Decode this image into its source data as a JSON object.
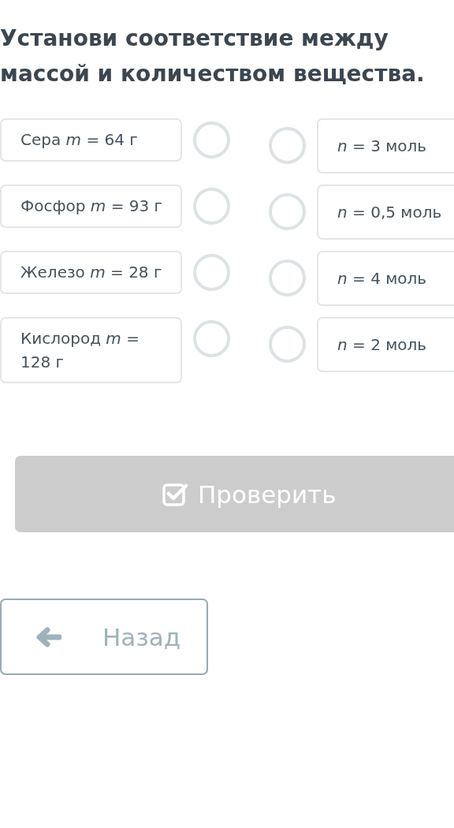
{
  "title": "Установи соответствие между массой и количеством вещества.",
  "left_items": [
    {
      "text": "Сера *m* = 64 г",
      "selected": false
    },
    {
      "text": "Фосфор *m* = 93 г",
      "selected": false
    },
    {
      "text": "Железо *m* = 28 г",
      "selected": false
    },
    {
      "text": "Кислород *m* = 128 г",
      "selected": false
    }
  ],
  "right_items": [
    {
      "text": "*n* = 3 моль",
      "selected": false
    },
    {
      "text": "*n* = 0,5 моль",
      "selected": false
    },
    {
      "text": "*n* = 4 моль",
      "selected": false
    },
    {
      "text": "*n* = 2 моль",
      "selected": false
    }
  ],
  "check_button": {
    "label": "Проверить",
    "disabled": true
  },
  "back_button": {
    "label": "Назад"
  }
}
